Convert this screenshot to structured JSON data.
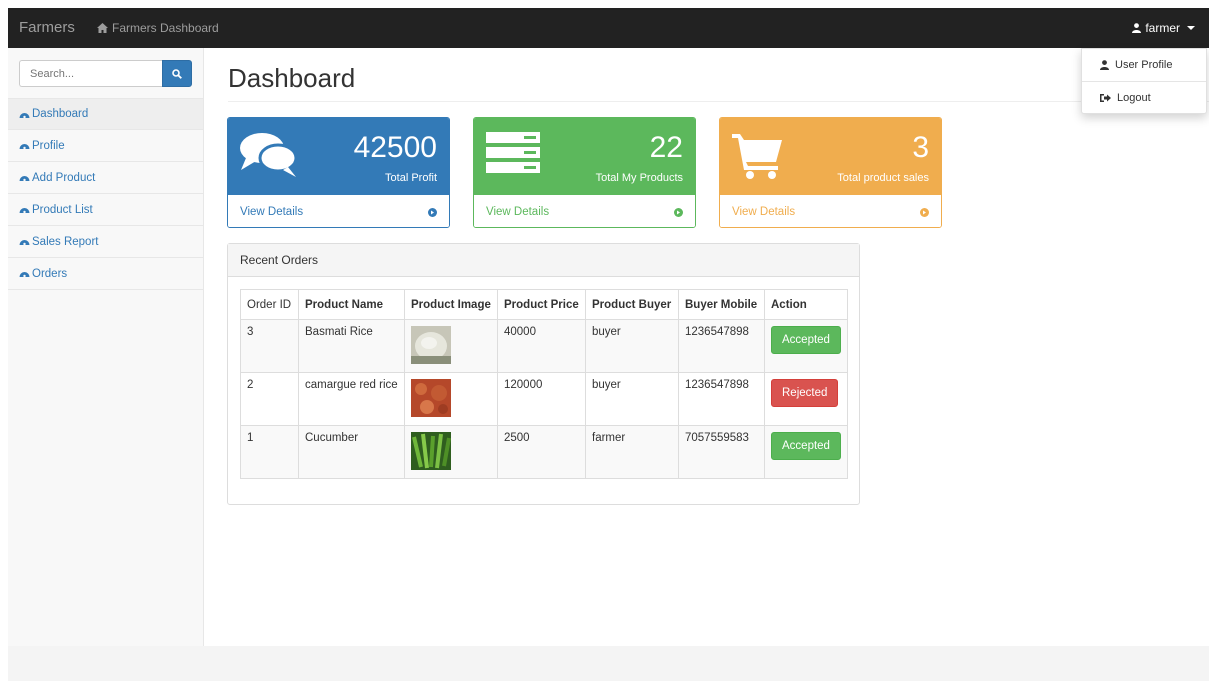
{
  "navbar": {
    "brand": "Farmers",
    "crumb": "Farmers Dashboard",
    "user": "farmer"
  },
  "dropdown": {
    "items": [
      {
        "label": "User Profile",
        "icon": "user-icon"
      },
      {
        "label": "Logout",
        "icon": "sign-out-icon"
      }
    ]
  },
  "sidebar": {
    "search_placeholder": "Search...",
    "items": [
      {
        "label": "Dashboard",
        "active": true
      },
      {
        "label": "Profile"
      },
      {
        "label": "Add Product"
      },
      {
        "label": "Product List"
      },
      {
        "label": "Sales Report"
      },
      {
        "label": "Orders"
      }
    ]
  },
  "page": {
    "title": "Dashboard"
  },
  "cards": [
    {
      "value": "42500",
      "label": "Total Profit",
      "link": "View Details",
      "color": "#337ab7",
      "icon": "comments-icon"
    },
    {
      "value": "22",
      "label": "Total My Products",
      "link": "View Details",
      "color": "#5cb85c",
      "icon": "server-icon"
    },
    {
      "value": "3",
      "label": "Total product sales",
      "link": "View Details",
      "color": "#f0ad4e",
      "icon": "shopping-cart-icon"
    }
  ],
  "orders": {
    "title": "Recent Orders",
    "columns": [
      "Order ID",
      "Product Name",
      "Product Image",
      "Product Price",
      "Product Buyer",
      "Buyer Mobile",
      "Action"
    ],
    "rows": [
      {
        "id": "3",
        "name": "Basmati Rice",
        "price": "40000",
        "buyer": "buyer",
        "mobile": "1236547898",
        "action": "Accepted",
        "status": "success"
      },
      {
        "id": "2",
        "name": "camargue red rice",
        "price": "120000",
        "buyer": "buyer",
        "mobile": "1236547898",
        "action": "Rejected",
        "status": "danger"
      },
      {
        "id": "1",
        "name": "Cucumber",
        "price": "2500",
        "buyer": "farmer",
        "mobile": "7057559583",
        "action": "Accepted",
        "status": "success"
      }
    ]
  }
}
